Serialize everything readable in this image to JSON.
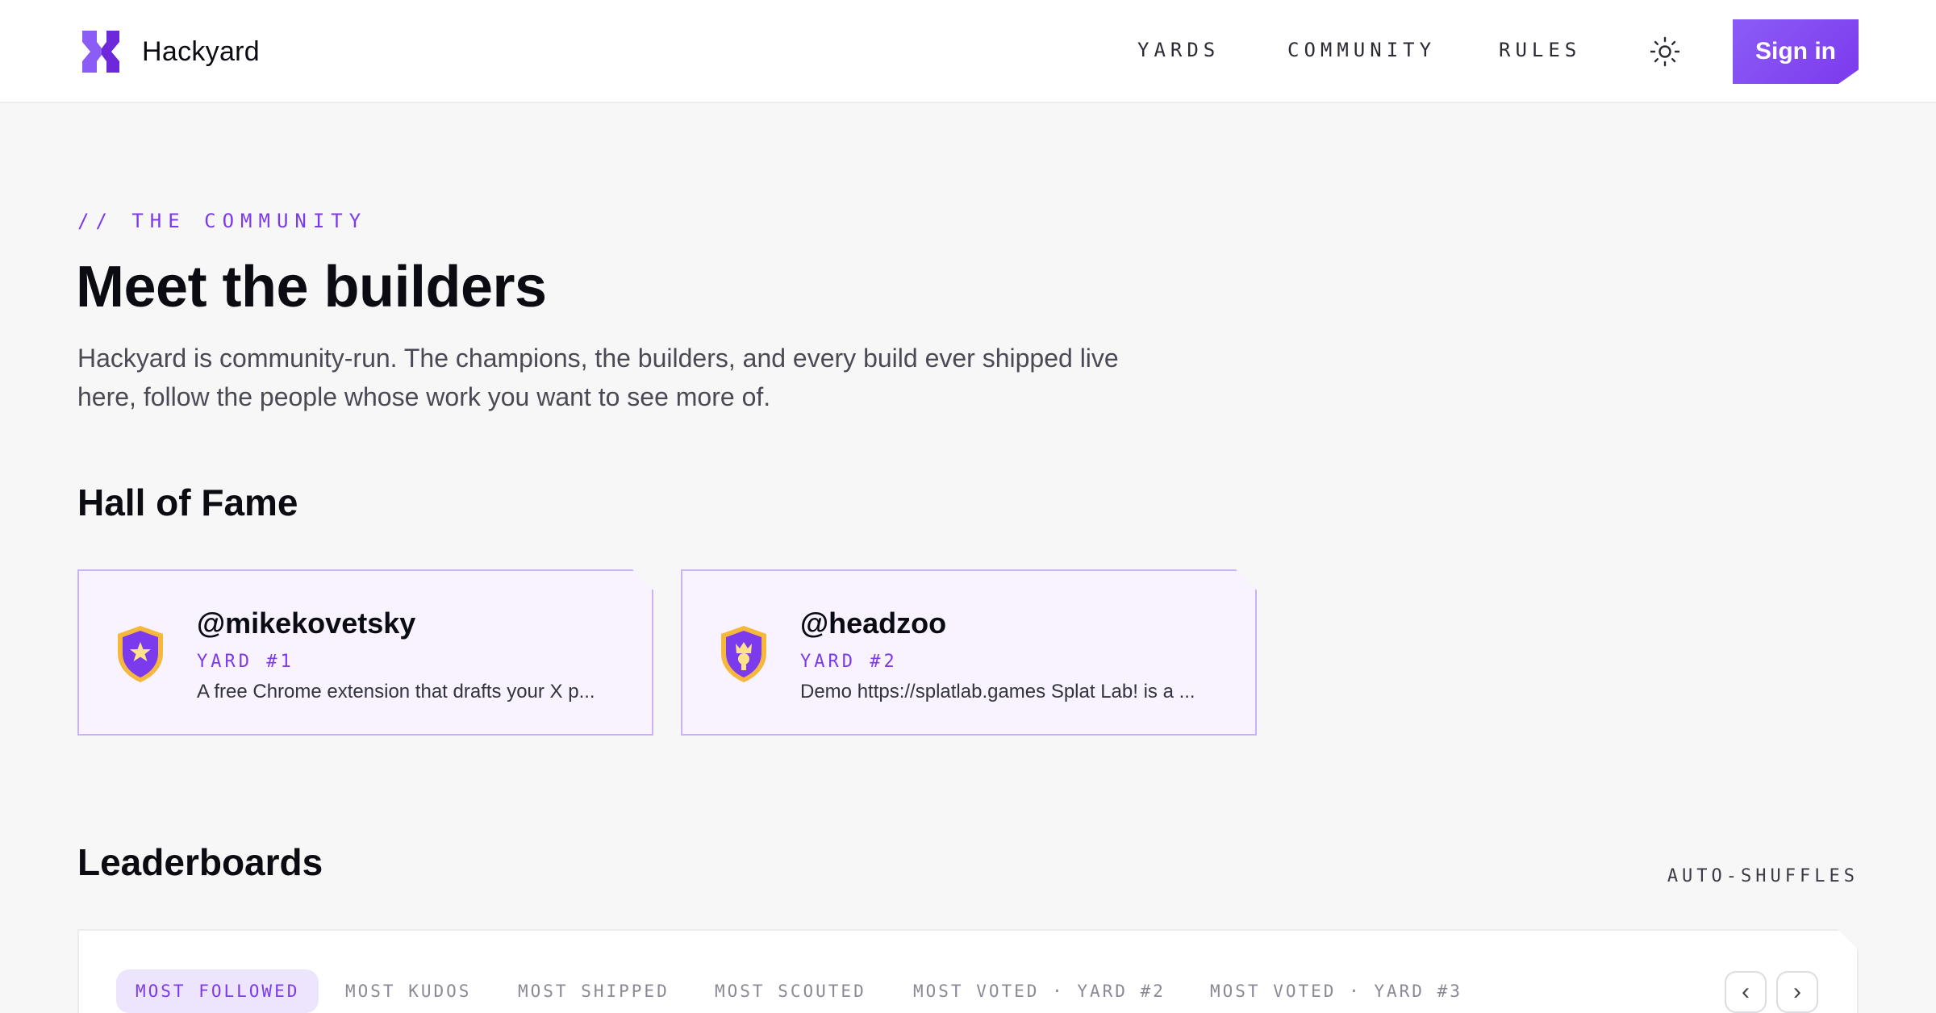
{
  "brand": {
    "name": "Hackyard",
    "logo_icon": "hackyard-logo-icon",
    "accent": "#7c3aed"
  },
  "nav": {
    "items": [
      {
        "label": "YARDS"
      },
      {
        "label": "COMMUNITY"
      },
      {
        "label": "RULES"
      }
    ],
    "theme_icon": "sun-icon",
    "signin_label": "Sign in"
  },
  "hero": {
    "eyebrow": "// THE COMMUNITY",
    "title": "Meet the builders",
    "description": "Hackyard is community-run. The champions, the builders, and every build ever shipped live here, follow the people whose work you want to see more of."
  },
  "hall_of_fame": {
    "title": "Hall of Fame",
    "cards": [
      {
        "handle": "@mikekovetsky",
        "yard": "YARD #1",
        "excerpt": "A free Chrome extension that drafts your X p...",
        "badge_icon": "star-shield-icon"
      },
      {
        "handle": "@headzoo",
        "yard": "YARD #2",
        "excerpt": "Demo https://splatlab.games Splat Lab! is a ...",
        "badge_icon": "crown-shield-icon"
      }
    ]
  },
  "leaderboards": {
    "title": "Leaderboards",
    "auto_label": "AUTO-SHUFFLES",
    "tabs": [
      {
        "label": "MOST FOLLOWED",
        "active": true
      },
      {
        "label": "MOST KUDOS",
        "active": false
      },
      {
        "label": "MOST SHIPPED",
        "active": false
      },
      {
        "label": "MOST SCOUTED",
        "active": false
      },
      {
        "label": "MOST VOTED · YARD #2",
        "active": false
      },
      {
        "label": "MOST VOTED · YARD #3",
        "active": false
      }
    ],
    "prev_icon": "chevron-left-icon",
    "next_icon": "chevron-right-icon",
    "prev_glyph": "‹",
    "next_glyph": "›"
  }
}
